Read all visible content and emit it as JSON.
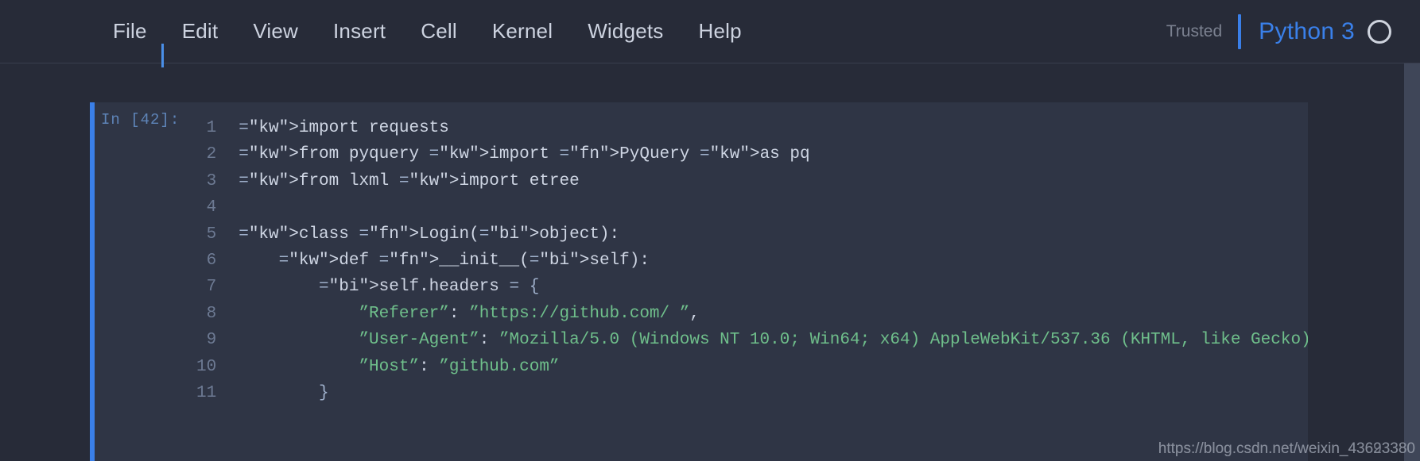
{
  "app": {
    "name": "Jupyter Notebook",
    "theme_background": "#272b38",
    "cell_background": "#2f3545",
    "accent_blue": "#3a7fe8"
  },
  "menubar": {
    "items": [
      {
        "label": "File"
      },
      {
        "label": "Edit"
      },
      {
        "label": "View"
      },
      {
        "label": "Insert"
      },
      {
        "label": "Cell"
      },
      {
        "label": "Kernel"
      },
      {
        "label": "Widgets"
      },
      {
        "label": "Help"
      }
    ],
    "trusted_label": "Trusted",
    "kernel_name": "Python 3",
    "kernel_indicator": "circle-idle-icon"
  },
  "cell": {
    "prompt": "In [42]:",
    "execution_count": "42",
    "line_numbers": [
      "1",
      "2",
      "3",
      "4",
      "5",
      "6",
      "7",
      "8",
      "9",
      "10",
      "11"
    ],
    "lines": [
      {
        "n": "1",
        "text": "import requests"
      },
      {
        "n": "2",
        "text": "from pyquery import PyQuery as pq"
      },
      {
        "n": "3",
        "text": "from lxml import etree"
      },
      {
        "n": "4",
        "text": ""
      },
      {
        "n": "5",
        "text": "class Login(object):"
      },
      {
        "n": "6",
        "text": "    def __init__(self):"
      },
      {
        "n": "7",
        "text": "        self.headers = {"
      },
      {
        "n": "8",
        "text": "            \"Referer\": \"https://github.com/ \","
      },
      {
        "n": "9",
        "text": "            \"User-Agent\": \"Mozilla/5.0 (Windows NT 10.0; Win64; x64) AppleWebKit/537.36 (KHTML, like Gecko) Chrome"
      },
      {
        "n": "10",
        "text": "            \"Host\": \"github.com\""
      },
      {
        "n": "11",
        "text": "        }"
      }
    ]
  },
  "watermark": {
    "text_a": "https://blog.csdn.net/weixin_43623380",
    "text_b": "https://blog.csdn.net/weixin_43693380"
  }
}
